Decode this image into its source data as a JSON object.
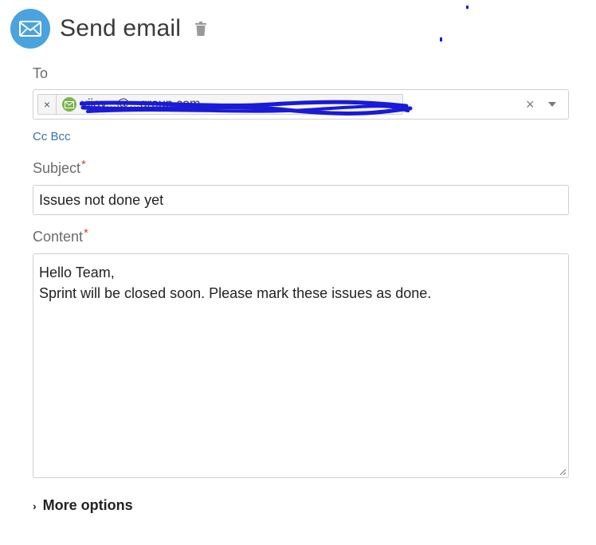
{
  "header": {
    "title": "Send email",
    "icons": [
      "mail-icon",
      "trash-icon"
    ]
  },
  "to": {
    "label": "To",
    "recipient": "vijay...@...group.com",
    "chip_remove": "×",
    "clear": "×"
  },
  "cc_bcc": "Cc Bcc",
  "subject": {
    "label": "Subject",
    "required": "*",
    "value": "Issues not done yet"
  },
  "content": {
    "label": "Content",
    "required": "*",
    "line1": "Hello Team,",
    "line2": "Sprint will be closed soon. Please mark these issues as done."
  },
  "more_options": {
    "chevron": "›",
    "label": "More options"
  },
  "colors": {
    "accent": "#4aa3df",
    "link": "#3572b0",
    "required": "#d04437",
    "avatar": "#7ab648",
    "redaction": "#1a1ad8"
  }
}
